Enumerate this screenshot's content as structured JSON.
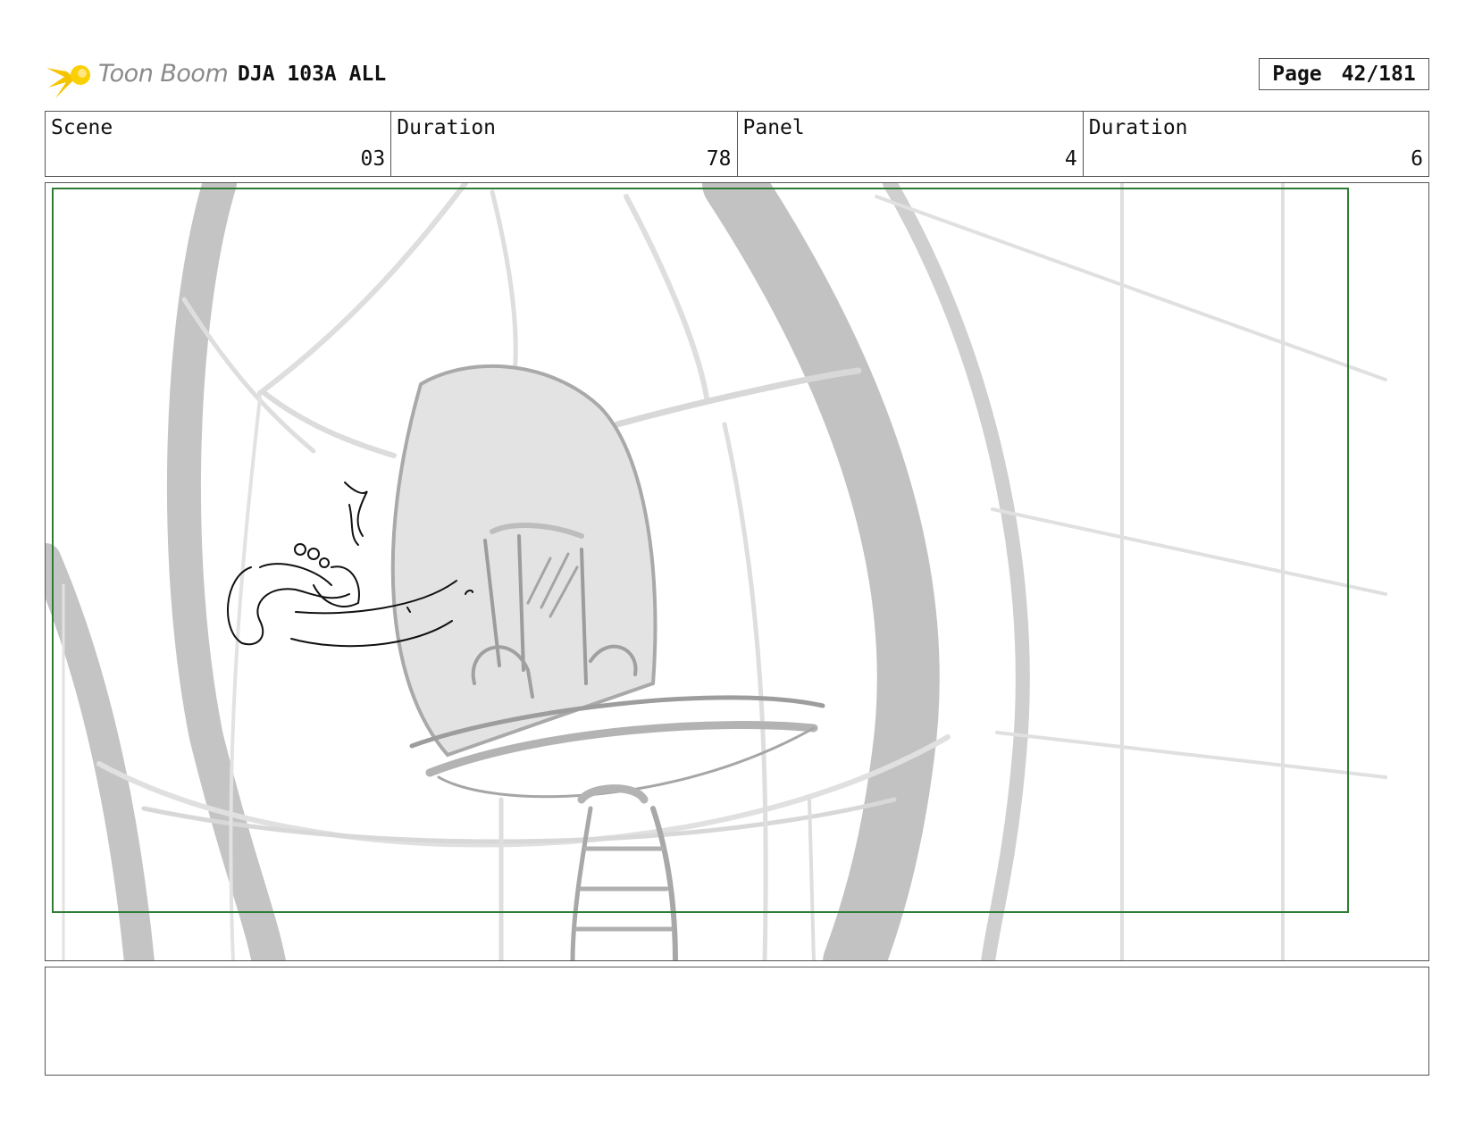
{
  "header": {
    "logo_text": "Toon Boom",
    "project_title": "DJA 103A ALL",
    "page_label": "Page",
    "page_number": "42/181"
  },
  "info": {
    "scene_label": "Scene",
    "scene_value": "03",
    "scene_duration_label": "Duration",
    "scene_duration_value": "78",
    "panel_label": "Panel",
    "panel_value": "4",
    "panel_duration_label": "Duration",
    "panel_duration_value": "6"
  },
  "notes": {
    "text": ""
  },
  "colors": {
    "safe_frame": "#2e7d32",
    "sketch_dark": "#bdbdbd",
    "sketch_light": "#dedede",
    "logo_accent": "#f5c400"
  }
}
